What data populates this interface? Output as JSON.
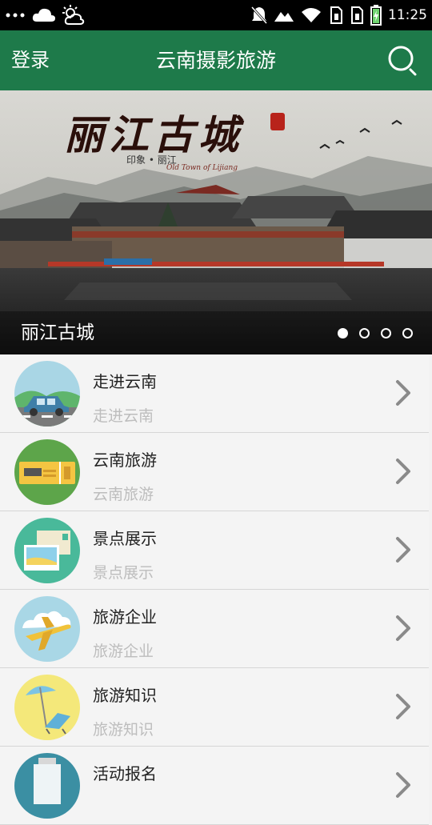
{
  "status_bar": {
    "time": "11:25",
    "icons": [
      "more-dots-icon",
      "cloud-icon",
      "sun-cloud-icon",
      "notifications-muted-icon",
      "mountain-icon",
      "wifi-icon",
      "sim1-icon",
      "sim2-icon",
      "battery-charging-icon"
    ]
  },
  "app_bar": {
    "login_label": "登录",
    "title": "云南摄影旅游",
    "search_icon": "search-icon"
  },
  "banner": {
    "caption": "丽江古城",
    "calligraphy_title": "丽江古城",
    "subtitle": "印象 • 丽江",
    "english_subtitle": "Old Town of Lijiang",
    "slide_count": 4,
    "active_slide": 1
  },
  "menu": {
    "items": [
      {
        "title": "走进云南",
        "subtitle": "走进云南",
        "icon": "car-landscape-icon"
      },
      {
        "title": "云南旅游",
        "subtitle": "云南旅游",
        "icon": "ticket-icon"
      },
      {
        "title": "景点展示",
        "subtitle": "景点展示",
        "icon": "postcard-icon"
      },
      {
        "title": "旅游企业",
        "subtitle": "旅游企业",
        "icon": "airplane-icon"
      },
      {
        "title": "旅游知识",
        "subtitle": "旅游知识",
        "icon": "beach-chair-icon"
      },
      {
        "title": "活动报名",
        "subtitle": "",
        "icon": "signup-icon"
      }
    ]
  },
  "colors": {
    "app_bar": "#1e7a4a",
    "status_bar": "#000000",
    "list_background": "#f4f4f4",
    "secondary_text": "#bdbdbd"
  }
}
